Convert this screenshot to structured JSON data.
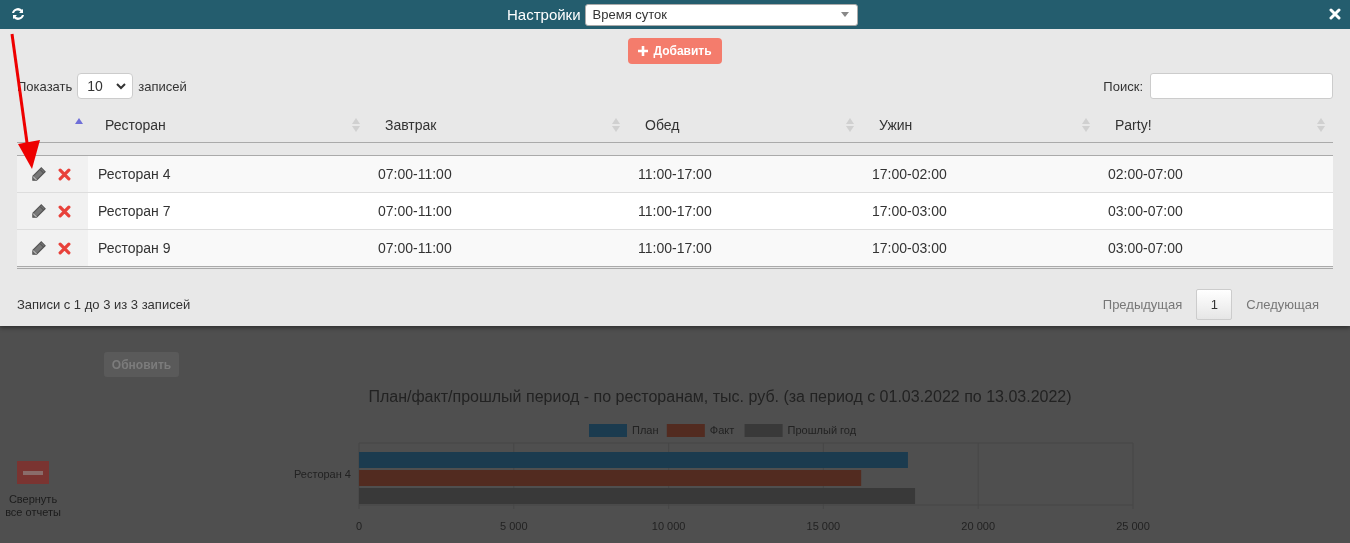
{
  "header": {
    "title": "Настройки",
    "select": {
      "value": "Время суток"
    }
  },
  "add_button": "Добавить",
  "length": {
    "before": "Показать",
    "value": "10",
    "after": "записей"
  },
  "search": {
    "label": "Поиск:"
  },
  "table": {
    "action_column": {
      "sorted": true
    },
    "columns": [
      {
        "label": "Ресторан",
        "sorted": false
      },
      {
        "label": "Завтрак",
        "sorted": false
      },
      {
        "label": "Обед",
        "sorted": false
      },
      {
        "label": "Ужин",
        "sorted": false
      },
      {
        "label": "Party!",
        "sorted": false
      }
    ],
    "rows": [
      {
        "cells": [
          "Ресторан 4",
          "07:00-11:00",
          "11:00-17:00",
          "17:00-02:00",
          "02:00-07:00"
        ]
      },
      {
        "cells": [
          "Ресторан 7",
          "07:00-11:00",
          "11:00-17:00",
          "17:00-03:00",
          "03:00-07:00"
        ]
      },
      {
        "cells": [
          "Ресторан 9",
          "07:00-11:00",
          "11:00-17:00",
          "17:00-03:00",
          "03:00-07:00"
        ]
      }
    ]
  },
  "info": "Записи с 1 до 3 из 3 записей",
  "pagination": {
    "previous": {
      "label": "Предыдущая",
      "disabled": true
    },
    "pages": [
      {
        "label": "1",
        "selected": true
      }
    ],
    "next": {
      "label": "Следующая",
      "disabled": true
    }
  },
  "background": {
    "update_button": "Обновить",
    "collapse_label": "Свернуть все отчеты",
    "chart_data": {
      "type": "bar",
      "orientation": "horizontal",
      "title": "План/факт/прошлый период - по ресторанам, тыс. руб. (за период с 01.03.2022 по 13.03.2022)",
      "categories": [
        "Ресторан 4"
      ],
      "series": [
        {
          "name": "План",
          "color": "#1b3b4f",
          "values": [
            17730
          ]
        },
        {
          "name": "Факт",
          "color": "#522b20",
          "values": [
            16220
          ]
        },
        {
          "name": "Прошлый год",
          "color": "#393939",
          "values": [
            17960
          ]
        }
      ],
      "grid": true,
      "legend": true,
      "xlim": [
        0,
        25000
      ],
      "xticks": [
        {
          "value": 0,
          "label": "0"
        },
        {
          "value": 5000,
          "label": "5 000"
        },
        {
          "value": 10000,
          "label": "10 000"
        },
        {
          "value": 15000,
          "label": "15 000"
        },
        {
          "value": 20000,
          "label": "20 000"
        },
        {
          "value": 25000,
          "label": "25 000"
        }
      ]
    }
  }
}
